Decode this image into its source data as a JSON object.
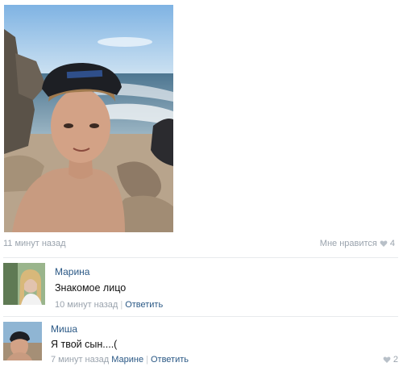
{
  "post": {
    "time": "11 минут назад",
    "like_label": "Мне нравится",
    "like_count": "4"
  },
  "comments": [
    {
      "author": "Марина",
      "text": "Знакомое лицо",
      "time": "10 минут назад",
      "reply_label": "Ответить",
      "likes": ""
    },
    {
      "author": "Миша",
      "text": "Я твой сын....(",
      "time": "7 минут назад",
      "reply_to": "Марине",
      "reply_label": "Ответить",
      "likes": "2"
    }
  ],
  "colors": {
    "link": "#2a5885",
    "muted": "#9aa3ad",
    "heart": "#b8c0c8"
  }
}
